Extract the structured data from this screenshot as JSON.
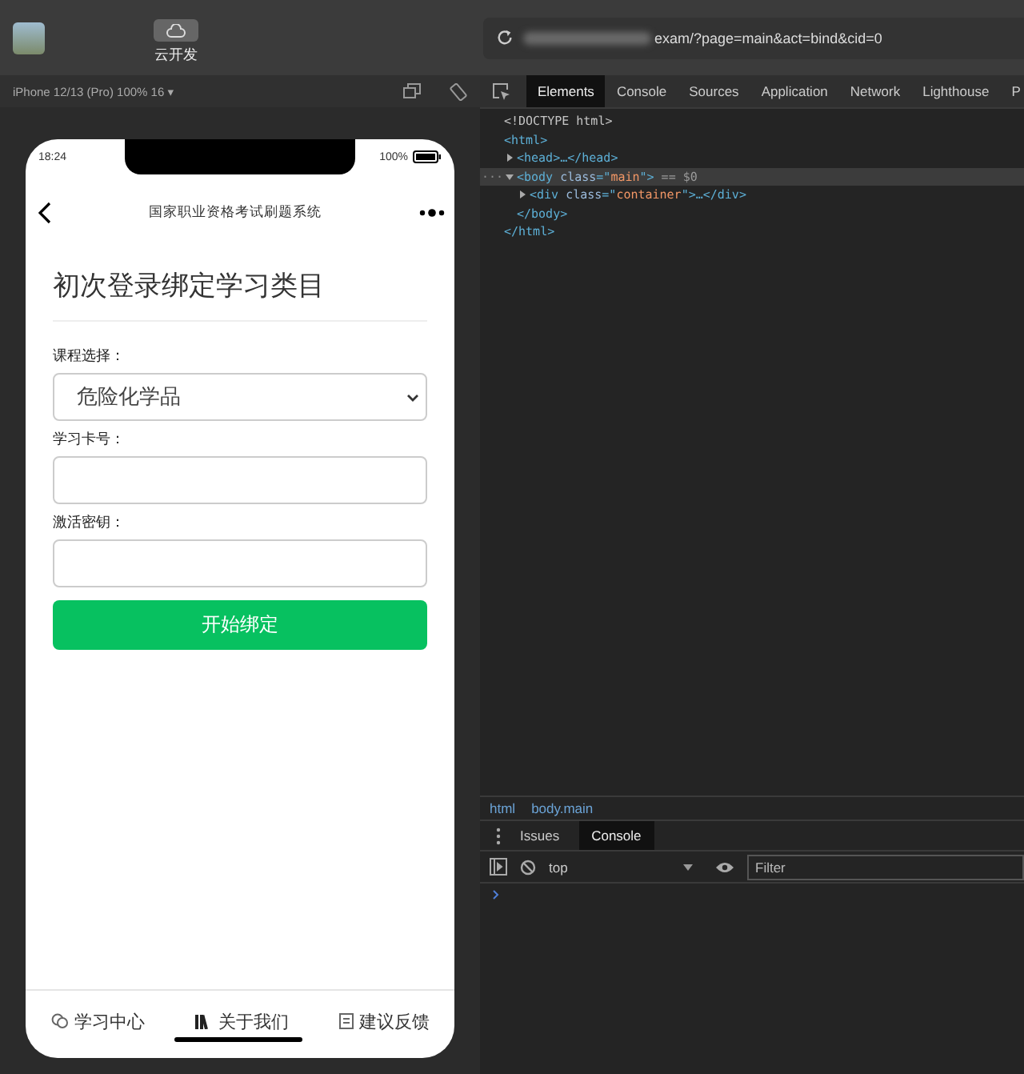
{
  "toolbar": {
    "cloud_button": "云开发",
    "url": "exam/?page=main&act=bind&cid=0"
  },
  "simulator": {
    "device": "iPhone 12/13 (Pro) 100% 16 ▾",
    "phone": {
      "time": "18:24",
      "battery": "100%",
      "nav_title": "国家职业资格考试刷题系统",
      "heading": "初次登录绑定学习类目",
      "fields": [
        {
          "kind": "select",
          "label": "课程选择：",
          "value": "危险化学品"
        },
        {
          "kind": "input",
          "label": "学习卡号："
        },
        {
          "kind": "input",
          "label": "激活密钥："
        }
      ],
      "submit": "开始绑定",
      "tabbar": [
        {
          "kind": "chat",
          "label": "学习中心"
        },
        {
          "kind": "books",
          "label": "关于我们"
        },
        {
          "kind": "note",
          "label": "建议反馈"
        }
      ]
    }
  },
  "devtools": {
    "tabs": [
      {
        "label": "Elements",
        "selected": true
      },
      {
        "label": "Console",
        "selected": false
      },
      {
        "label": "Sources",
        "selected": false
      },
      {
        "label": "Application",
        "selected": false
      },
      {
        "label": "Network",
        "selected": false
      },
      {
        "label": "Lighthouse",
        "selected": false
      },
      {
        "label": "P",
        "selected": false
      }
    ],
    "dom": [
      {
        "parts": [
          {
            "t": "<!DOCTYPE html>",
            "kind": "doctype"
          }
        ],
        "selected": false
      },
      {
        "parts": [
          {
            "t": "<html>",
            "kind": "tag"
          }
        ],
        "selected": false,
        "close": [
          {
            "t": "</html>",
            "kind": "tag"
          }
        ],
        "children": [
          {
            "parts": [
              {
                "t": "<head>…</head>",
                "kind": "tag"
              }
            ],
            "expanded": false,
            "selected": false
          },
          {
            "gutter": "···",
            "parts": [
              {
                "t": "<body ",
                "kind": "tag"
              },
              {
                "t": "class",
                "kind": "attr"
              },
              {
                "t": "=\"",
                "kind": "tag"
              },
              {
                "t": "main",
                "kind": "value"
              },
              {
                "t": "\">",
                "kind": "tag"
              },
              {
                "t": " == $0",
                "kind": "note"
              }
            ],
            "expanded": true,
            "selected": true,
            "close": [
              {
                "t": "</body>",
                "kind": "tag"
              }
            ],
            "children": [
              {
                "parts": [
                  {
                    "t": "<div ",
                    "kind": "tag"
                  },
                  {
                    "t": "class",
                    "kind": "attr"
                  },
                  {
                    "t": "=\"",
                    "kind": "tag"
                  },
                  {
                    "t": "container",
                    "kind": "value"
                  },
                  {
                    "t": "\">…</div>",
                    "kind": "tag"
                  }
                ],
                "expanded": false,
                "selected": false
              }
            ]
          }
        ]
      }
    ],
    "breadcrumb": [
      "html",
      "body.main"
    ],
    "drawer_tabs": [
      {
        "label": "Issues",
        "selected": false
      },
      {
        "label": "Console",
        "selected": true
      }
    ],
    "console": {
      "context": "top",
      "filter_placeholder": "Filter"
    }
  }
}
